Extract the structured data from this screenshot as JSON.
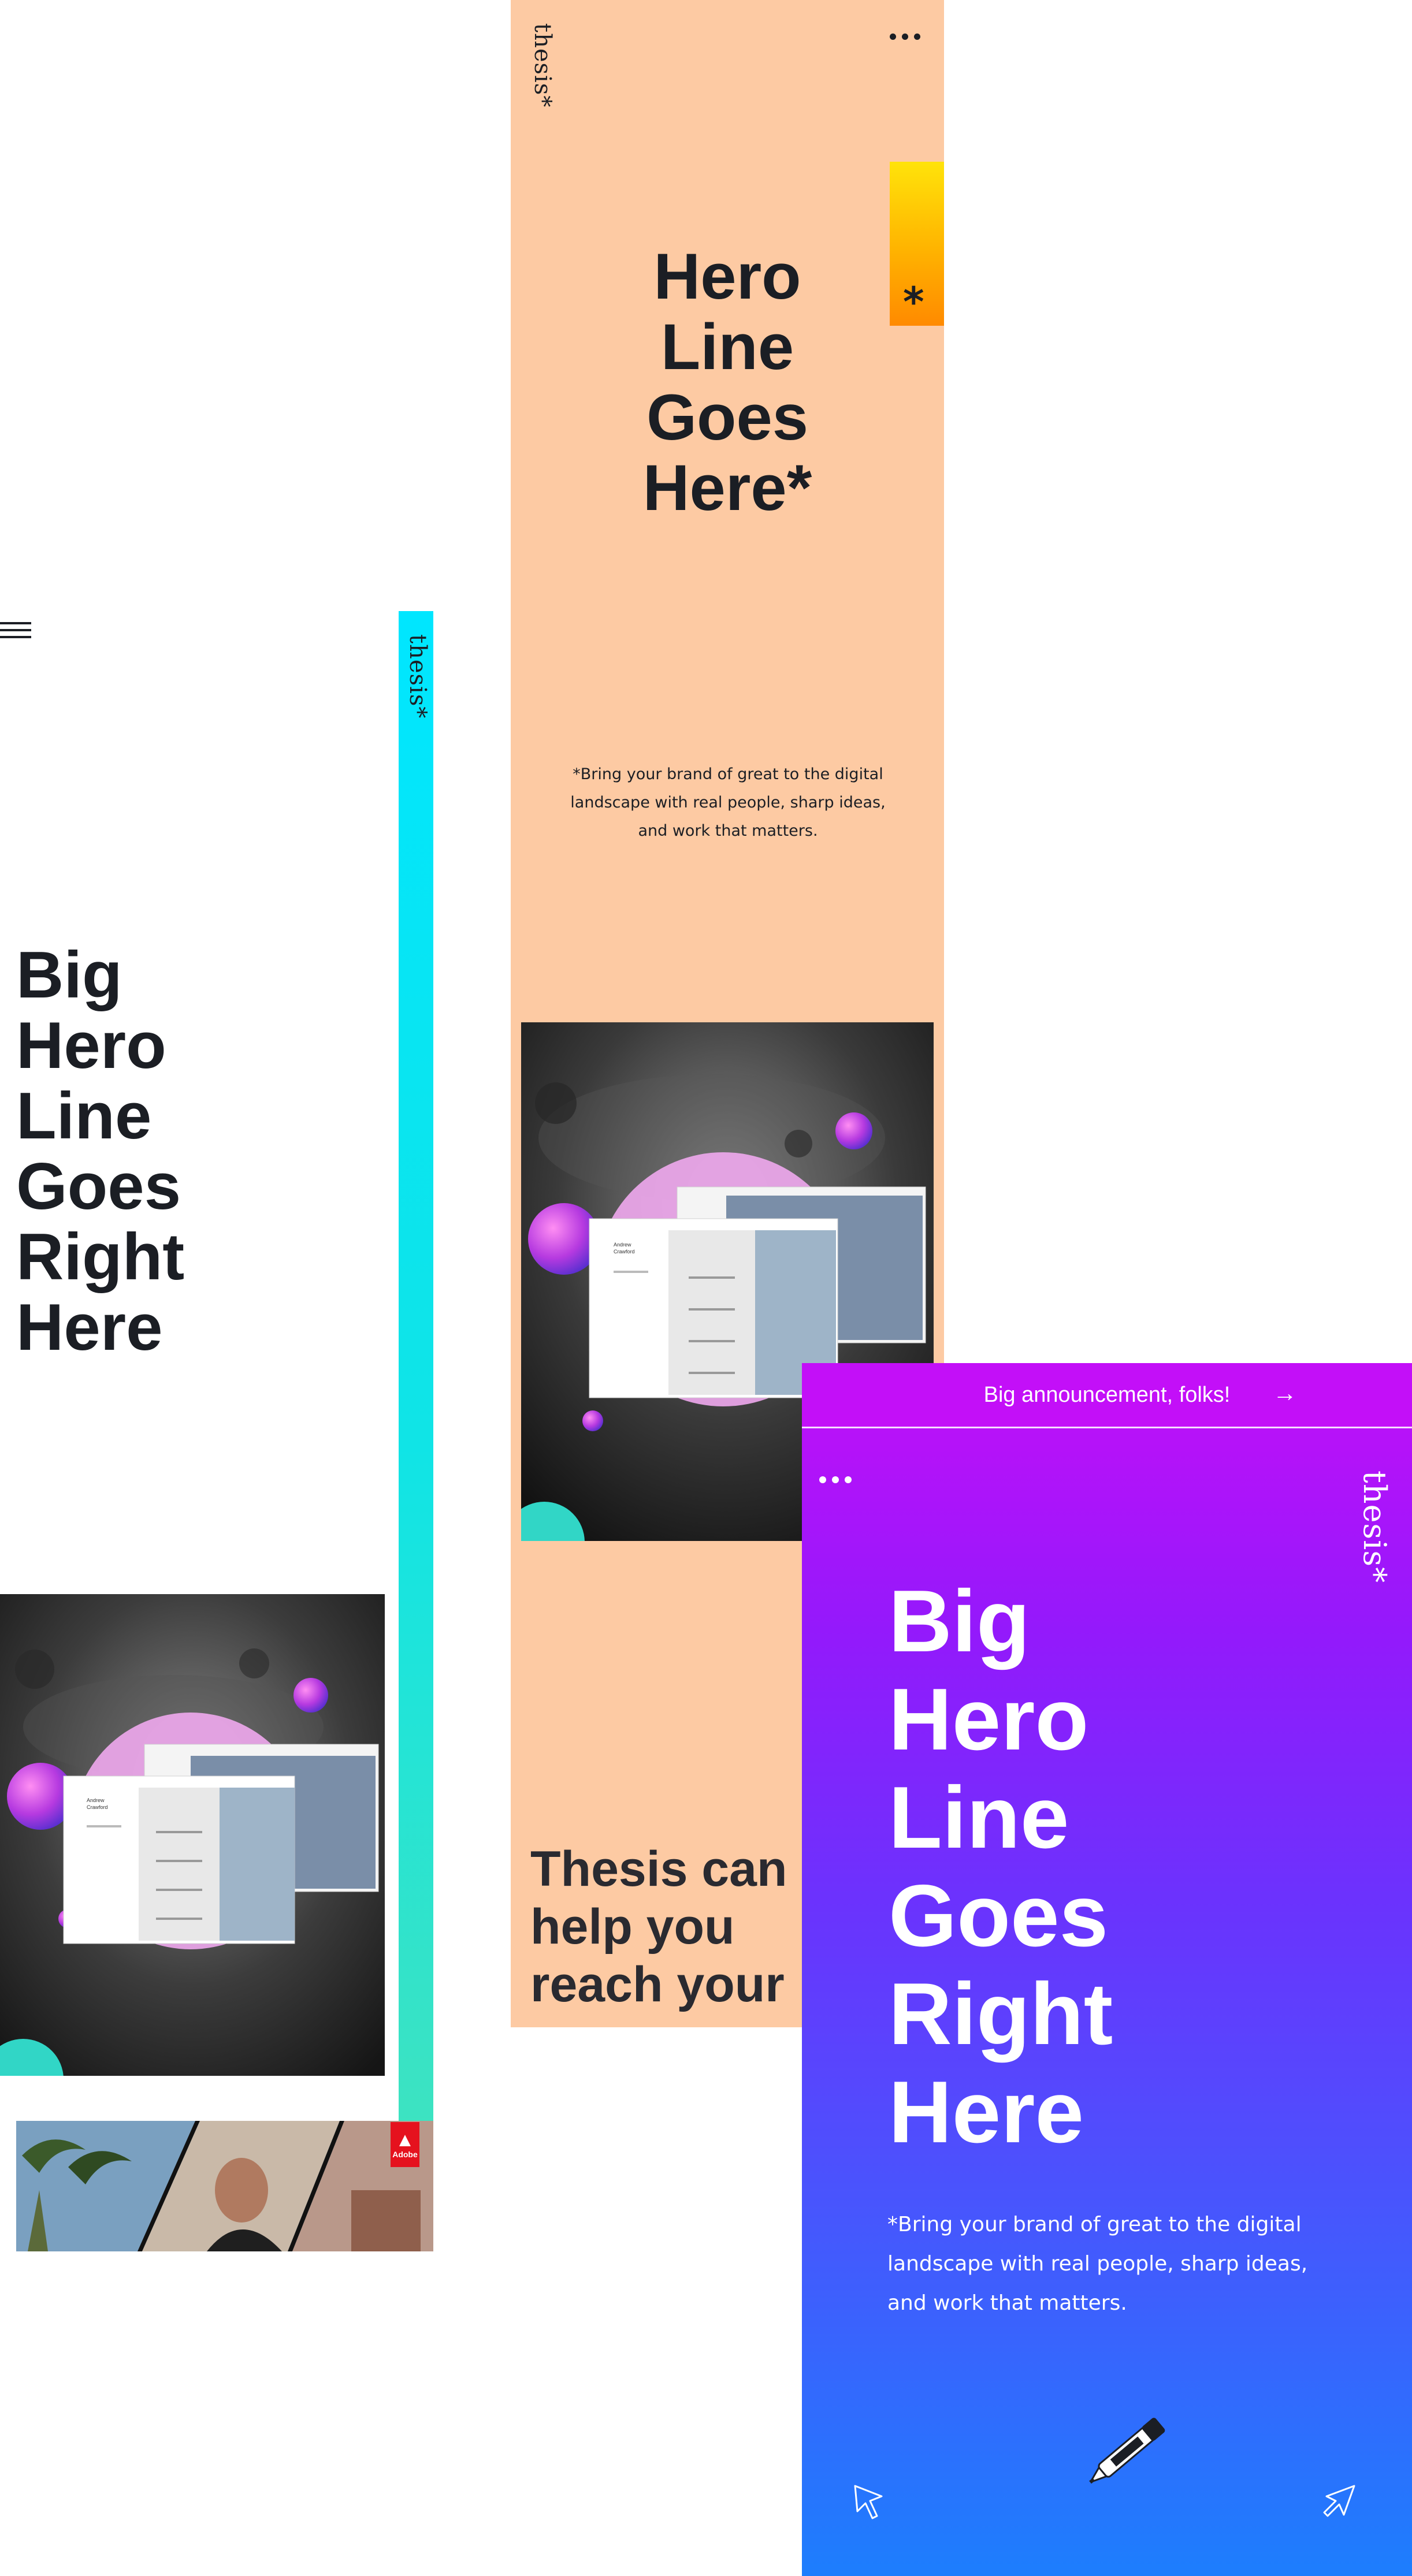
{
  "left_mockup": {
    "logo": "thesis*",
    "hero_title": "Big\nHero\nLine\nGoes\nRight\nHere",
    "accent_color": "#00e6ff",
    "badge_label": "Adobe"
  },
  "center_mockup": {
    "logo": "thesis*",
    "hero_title": "Hero\nLine\nGoes\nHere*",
    "tab_symbol": "*",
    "subtitle": "*Bring your brand of great to the digital landscape with real people, sharp ideas, and work that matters.",
    "section_heading": "Thesis can\nhelp you\nreach your",
    "background_color": "#fdcaa3"
  },
  "right_mockup": {
    "announcement": "Big announcement, folks!",
    "announcement_arrow": "→",
    "logo": "thesis*",
    "hero_title": "Big\nHero\nLine\nGoes\nRight\nHere",
    "subtitle": "*Bring your brand of great to the digital landscape with real people, sharp ideas, and work that matters.",
    "gradient_top": "#c30ff8",
    "gradient_bottom": "#1d7efd"
  },
  "app_preview": {
    "user_name": "Andrew\nCrawford"
  },
  "icons": [
    "hamburger-icon",
    "more-dots-icon",
    "arrow-right-icon",
    "cursor-arrow-icon",
    "marker-pen-icon",
    "adobe-logo-icon"
  ]
}
